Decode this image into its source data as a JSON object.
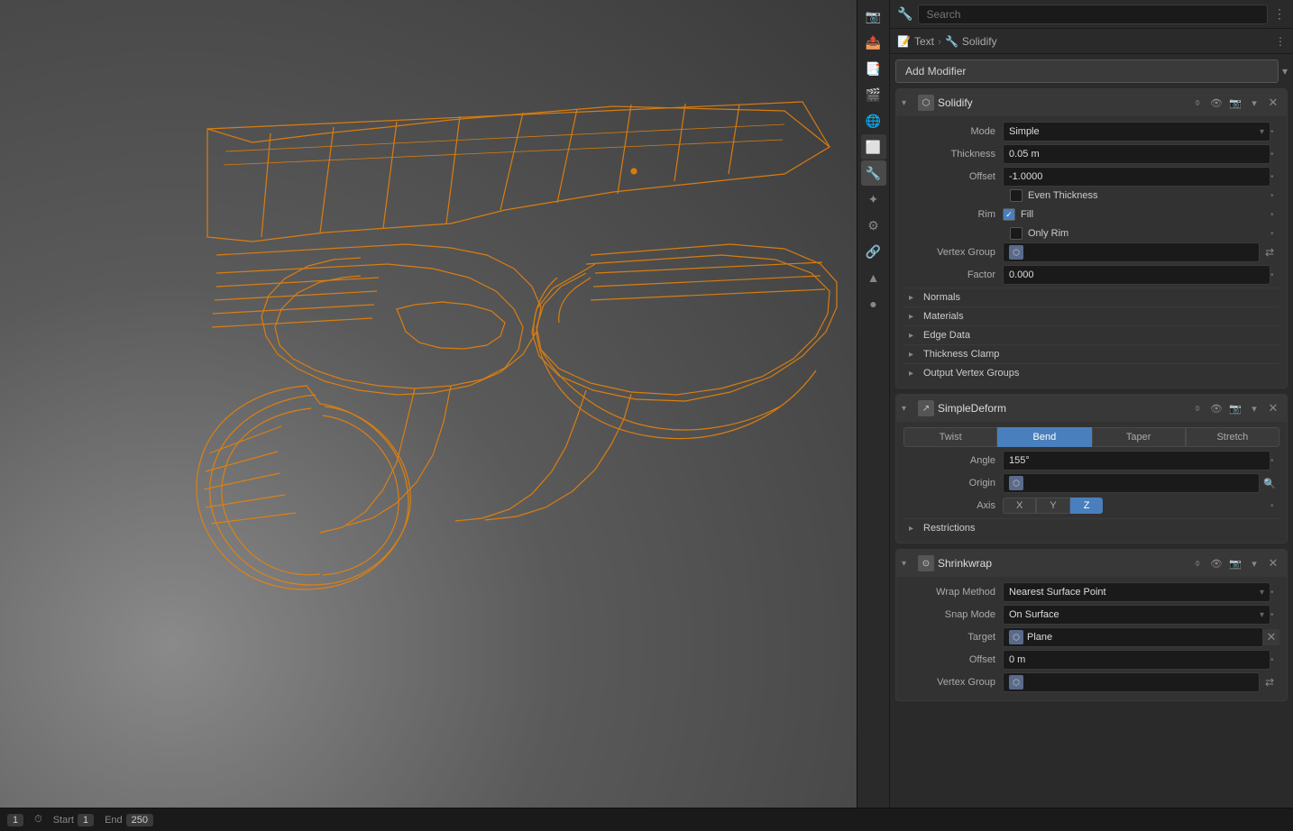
{
  "header": {
    "search_placeholder": "Search"
  },
  "breadcrumb": {
    "item1": "Text",
    "item2": "Solidify"
  },
  "addModifier": {
    "label": "Add Modifier",
    "arrow": "▾"
  },
  "solidify": {
    "name": "Solidify",
    "mode_label": "Mode",
    "mode_value": "Simple",
    "thickness_label": "Thickness",
    "thickness_value": "0.05 m",
    "offset_label": "Offset",
    "offset_value": "-1.0000",
    "even_thickness_label": "Even Thickness",
    "rim_label": "Rim",
    "fill_label": "Fill",
    "fill_checked": true,
    "only_rim_label": "Only Rim",
    "only_rim_checked": false,
    "vertex_group_label": "Vertex Group",
    "factor_label": "Factor",
    "factor_value": "0.000",
    "sections": {
      "normals": "Normals",
      "materials": "Materials",
      "edge_data": "Edge Data",
      "thickness_clamp": "Thickness Clamp",
      "output_vertex_groups": "Output Vertex Groups"
    }
  },
  "simpleDeform": {
    "name": "SimpleDeform",
    "tabs": [
      "Twist",
      "Bend",
      "Taper",
      "Stretch"
    ],
    "active_tab": "Bend",
    "angle_label": "Angle",
    "angle_value": "155°",
    "origin_label": "Origin",
    "axis_label": "Axis",
    "axis_x": "X",
    "axis_y": "Y",
    "axis_z": "Z",
    "active_axis": "Z",
    "sections": {
      "restrictions": "Restrictions"
    }
  },
  "shrinkwrap": {
    "name": "Shrinkwrap",
    "wrap_method_label": "Wrap Method",
    "wrap_method_value": "Nearest Surface Point",
    "snap_mode_label": "Snap Mode",
    "snap_mode_value": "On Surface",
    "target_label": "Target",
    "target_value": "Plane",
    "offset_label": "Offset",
    "offset_value": "0 m",
    "vertex_group_label": "Vertex Group"
  },
  "statusBar": {
    "frame_label": "1",
    "start_label": "Start",
    "start_value": "1",
    "end_label": "End",
    "end_value": "250"
  },
  "icons": {
    "wrench": "🔧",
    "scene": "🎬",
    "view": "👁",
    "object": "⬜",
    "data": "▲",
    "material": "●",
    "particle": "✦",
    "physics": "⚙",
    "constraint": "🔗",
    "modifier": "🔧",
    "tool": "✱",
    "scene_props": "⬡",
    "world": "🌐",
    "render": "📷",
    "output": "📤",
    "view_layer": "📑",
    "expand": "▸",
    "collapse": "▾",
    "close": "✕",
    "swap": "⇄",
    "dots": "⋮",
    "funnel": "⌽",
    "camera": "📷",
    "eye": "👁"
  }
}
